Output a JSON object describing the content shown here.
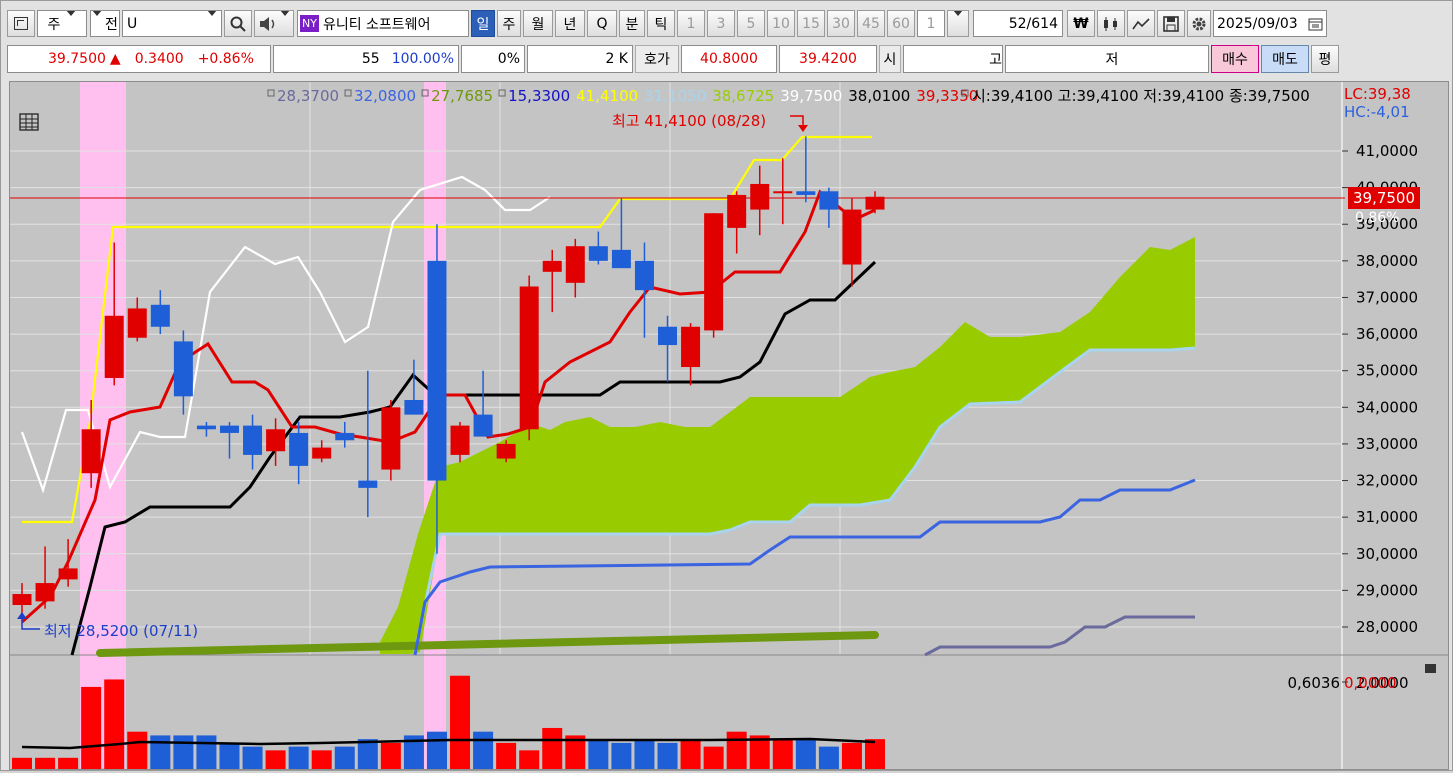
{
  "toolbar": {
    "type_label": "주",
    "prev_label": "전",
    "symbol_value": "U",
    "market_badge": "NY",
    "stock_name": "유니티 소프트웨어",
    "periods": [
      "일",
      "주",
      "월",
      "년",
      "Q",
      "분",
      "틱"
    ],
    "intervals": [
      "1",
      "3",
      "5",
      "10",
      "15",
      "30",
      "45",
      "60",
      "1"
    ],
    "count_current": "52",
    "count_total": "/614",
    "date": "2025/09/03"
  },
  "quote": {
    "price": "39.7500",
    "arrow": "▲",
    "change": "0.3400",
    "change_pct": "+0.86%",
    "strength": "55",
    "strength_pct": "100.00%",
    "zero_pct": "0%",
    "volume": "2 K",
    "hoga_label": "호가",
    "hoga_ask": "40.8000",
    "hoga_bid": "39.4200",
    "open_label": "시",
    "high_label": "고",
    "low_label": "저",
    "buy_label": "매수",
    "sell_label": "매도",
    "avg_label": "평"
  },
  "legend": {
    "values": [
      {
        "text": "28,3700",
        "color": "#6a6a9c"
      },
      {
        "text": "32,0800",
        "color": "#3b64e0"
      },
      {
        "text": "27,7685",
        "color": "#6e9810"
      },
      {
        "text": "15,3300",
        "color": "#1212c8"
      },
      {
        "text": "41,4100",
        "color": "#ffff00"
      },
      {
        "text": "31,1050",
        "color": "#a8d4ee"
      },
      {
        "text": "38,6725",
        "color": "#9acd00"
      },
      {
        "text": "39,7500",
        "color": "#ffffff"
      },
      {
        "text": "38,0100",
        "color": "#000000"
      },
      {
        "text": "39,3350",
        "color": "#e00000"
      }
    ],
    "ohlc": "시:39,4100 고:39,4100 저:39,4100 종:39,7500",
    "lc": "LC:39,38",
    "hc": "HC:-4,01"
  },
  "annotations": {
    "high": "최고 41,4100 (08/28)",
    "low": "최저 28,5200 (07/11)",
    "current_price": "39,7500",
    "current_pct": "0,86%",
    "volume_values": {
      "v1": "0,6036",
      "v2": "0,0000"
    }
  },
  "chart_data": {
    "type": "candlestick",
    "ylim": [
      27.5,
      42.0
    ],
    "yticks": [
      "41,0000",
      "40,0000",
      "39,0000",
      "38,0000",
      "37,0000",
      "36,0000",
      "35,0000",
      "34,0000",
      "33,0000",
      "32,0000",
      "31,0000",
      "30,0000",
      "29,0000",
      "28,0000"
    ],
    "volume_ticks": [
      "2,0000"
    ],
    "candles": [
      {
        "o": 28.6,
        "h": 29.2,
        "l": 28.3,
        "c": 28.9
      },
      {
        "o": 28.7,
        "h": 30.2,
        "l": 28.5,
        "c": 29.2
      },
      {
        "o": 29.3,
        "h": 30.4,
        "l": 29.1,
        "c": 29.6
      },
      {
        "o": 32.2,
        "h": 34.2,
        "l": 31.8,
        "c": 33.4
      },
      {
        "o": 34.8,
        "h": 38.5,
        "l": 34.6,
        "c": 36.5
      },
      {
        "o": 35.9,
        "h": 37.0,
        "l": 35.8,
        "c": 36.7
      },
      {
        "o": 36.8,
        "h": 37.2,
        "l": 36.0,
        "c": 36.2
      },
      {
        "o": 35.8,
        "h": 36.1,
        "l": 33.8,
        "c": 34.3
      },
      {
        "o": 33.5,
        "h": 33.6,
        "l": 33.2,
        "c": 33.4
      },
      {
        "o": 33.5,
        "h": 33.6,
        "l": 32.6,
        "c": 33.3
      },
      {
        "o": 33.5,
        "h": 33.8,
        "l": 32.3,
        "c": 32.7
      },
      {
        "o": 32.8,
        "h": 33.7,
        "l": 32.4,
        "c": 33.4
      },
      {
        "o": 33.3,
        "h": 33.6,
        "l": 31.9,
        "c": 32.4
      },
      {
        "o": 32.6,
        "h": 33.1,
        "l": 32.5,
        "c": 32.9
      },
      {
        "o": 33.3,
        "h": 33.6,
        "l": 32.9,
        "c": 33.1
      },
      {
        "o": 32.0,
        "h": 35.0,
        "l": 31.0,
        "c": 31.8
      },
      {
        "o": 32.3,
        "h": 34.2,
        "l": 32.0,
        "c": 34.0
      },
      {
        "o": 34.2,
        "h": 35.3,
        "l": 34.0,
        "c": 33.8
      },
      {
        "o": 38.0,
        "h": 39.0,
        "l": 30.0,
        "c": 32.0
      },
      {
        "o": 32.7,
        "h": 33.6,
        "l": 32.5,
        "c": 33.5
      },
      {
        "o": 33.8,
        "h": 35.0,
        "l": 33.2,
        "c": 33.2
      },
      {
        "o": 32.6,
        "h": 33.1,
        "l": 32.5,
        "c": 33.0
      },
      {
        "o": 33.4,
        "h": 37.6,
        "l": 33.1,
        "c": 37.3
      },
      {
        "o": 37.7,
        "h": 38.3,
        "l": 36.6,
        "c": 38.0
      },
      {
        "o": 37.4,
        "h": 38.6,
        "l": 37.0,
        "c": 38.4
      },
      {
        "o": 38.4,
        "h": 38.8,
        "l": 37.9,
        "c": 38.0
      },
      {
        "o": 38.3,
        "h": 39.7,
        "l": 37.9,
        "c": 37.8
      },
      {
        "o": 38.0,
        "h": 38.5,
        "l": 35.9,
        "c": 37.2
      },
      {
        "o": 36.2,
        "h": 36.5,
        "l": 34.7,
        "c": 35.7
      },
      {
        "o": 35.1,
        "h": 36.3,
        "l": 34.6,
        "c": 36.2
      },
      {
        "o": 36.1,
        "h": 39.3,
        "l": 35.9,
        "c": 39.3
      },
      {
        "o": 38.9,
        "h": 39.9,
        "l": 38.2,
        "c": 39.8
      },
      {
        "o": 39.4,
        "h": 40.6,
        "l": 38.7,
        "c": 40.1
      },
      {
        "o": 39.9,
        "h": 40.8,
        "l": 39.0,
        "c": 39.9
      },
      {
        "o": 39.9,
        "h": 41.4,
        "l": 39.6,
        "c": 39.8
      },
      {
        "o": 39.9,
        "h": 40.0,
        "l": 38.9,
        "c": 39.4
      },
      {
        "o": 37.9,
        "h": 39.7,
        "l": 37.3,
        "c": 39.4
      },
      {
        "o": 39.4,
        "h": 39.9,
        "l": 39.3,
        "c": 39.75
      }
    ],
    "volumes": [
      0.3,
      0.3,
      0.3,
      2.2,
      2.4,
      1.0,
      0.9,
      0.9,
      0.9,
      0.7,
      0.6,
      0.5,
      0.6,
      0.5,
      0.6,
      0.8,
      0.7,
      0.9,
      1.0,
      2.5,
      1.0,
      0.7,
      0.5,
      1.1,
      0.9,
      0.8,
      0.7,
      0.8,
      0.7,
      0.8,
      0.6,
      1.0,
      0.9,
      0.8,
      0.8,
      0.6,
      0.7,
      0.8,
      0.0
    ],
    "volume_ylim": [
      0,
      2.6
    ]
  }
}
